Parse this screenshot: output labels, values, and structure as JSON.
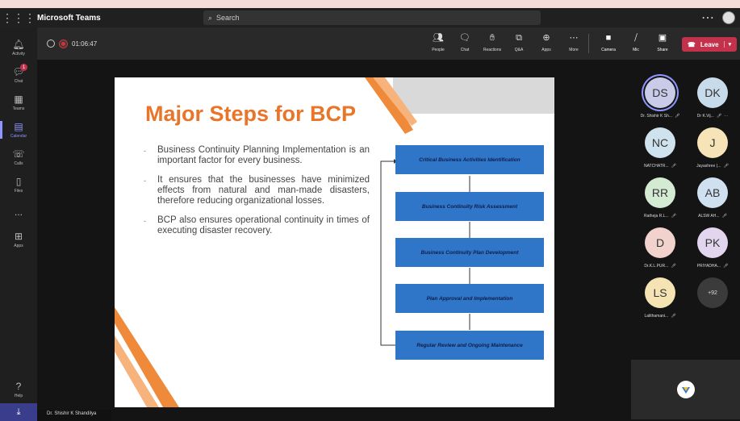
{
  "app": {
    "name": "Microsoft Teams"
  },
  "search": {
    "placeholder": "Search"
  },
  "rail": {
    "items": [
      {
        "label": "Activity",
        "icon": "bell-icon"
      },
      {
        "label": "Chat",
        "icon": "chat-icon",
        "badge": "1"
      },
      {
        "label": "Teams",
        "icon": "teams-icon"
      },
      {
        "label": "Calendar",
        "icon": "calendar-icon"
      },
      {
        "label": "Calls",
        "icon": "phone-icon"
      },
      {
        "label": "Files",
        "icon": "file-icon"
      },
      {
        "label": "...",
        "icon": "more-icon"
      },
      {
        "label": "Apps",
        "icon": "apps-icon"
      }
    ],
    "help": "Help"
  },
  "meeting": {
    "timer": "01:06:47",
    "controls": [
      {
        "label": "People",
        "icon": "people-icon"
      },
      {
        "label": "Chat",
        "icon": "chat-icon"
      },
      {
        "label": "Reactions",
        "icon": "reactions-icon"
      },
      {
        "label": "Q&A",
        "icon": "qa-icon"
      },
      {
        "label": "Apps",
        "icon": "apps-icon"
      },
      {
        "label": "More",
        "icon": "more-icon"
      },
      {
        "label": "Camera",
        "icon": "camera-icon"
      },
      {
        "label": "Mic",
        "icon": "mic-icon"
      },
      {
        "label": "Share",
        "icon": "share-icon"
      }
    ],
    "leave_label": "Leave"
  },
  "slide": {
    "title": "Major Steps for BCP",
    "bullets": [
      "Business Continuity Planning Implementation is an important factor for every business.",
      "It ensures that the businesses have minimized effects from natural and man-made disasters, therefore reducing organizational losses.",
      "BCP also ensures operational continuity in times of executing disaster recovery."
    ],
    "flow": [
      "Critical Business Activities Identification",
      "Business Continuity Risk Assessment",
      "Business Continuity Plan Development",
      "Plan Approval and Implementation",
      "Regular Review and Ongoing Maintenance"
    ]
  },
  "presenter": {
    "name": "Dr. Shishir K Shandilya"
  },
  "participants": [
    {
      "initials": "DS",
      "name": "Dr. Shishir K Sh...",
      "color": "#c9cbe8",
      "ring": true
    },
    {
      "initials": "DK",
      "name": "Dr K.Vij...",
      "color": "#c8dbea"
    },
    {
      "initials": "NC",
      "name": "NATCHATR...",
      "color": "#cfe3ee"
    },
    {
      "initials": "J",
      "name": "Jayashree (...",
      "color": "#f6e3b8"
    },
    {
      "initials": "RR",
      "name": "Ratheja R.L...",
      "color": "#d3ebd3"
    },
    {
      "initials": "AB",
      "name": "ALSW AH...",
      "color": "#cfe0f0"
    },
    {
      "initials": "D",
      "name": "Dr.K.L.PUR...",
      "color": "#f2d2cc"
    },
    {
      "initials": "PK",
      "name": "PRIYADHA...",
      "color": "#e1d6ee"
    },
    {
      "initials": "LS",
      "name": "Lalithamani...",
      "color": "#f5e3b4"
    },
    {
      "initials": "+92",
      "name": "",
      "color": "#3b3b3b"
    }
  ],
  "colors": {
    "accent": "#8f95ff",
    "leave": "#c4314b",
    "title": "#e8752a",
    "flow_box": "#2f75c8"
  }
}
